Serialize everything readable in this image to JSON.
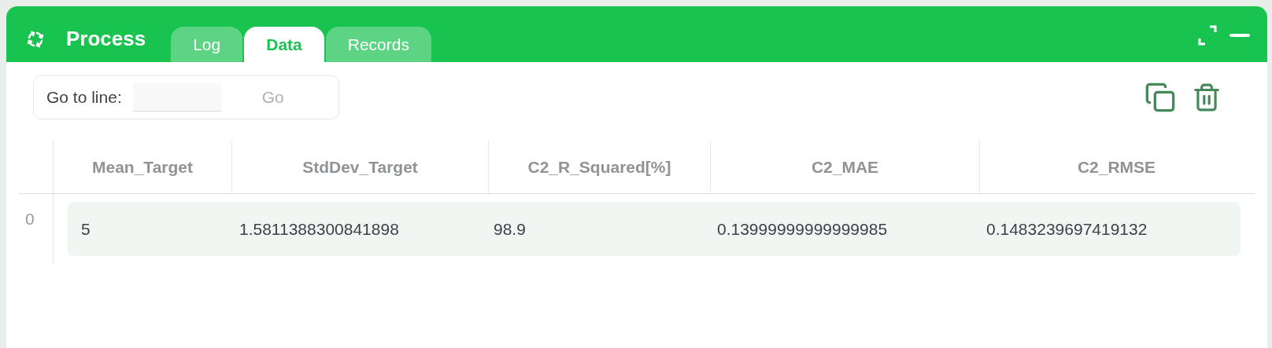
{
  "window": {
    "title": "Process"
  },
  "tabs": [
    {
      "label": "Log",
      "selected": false
    },
    {
      "label": "Data",
      "selected": true
    },
    {
      "label": "Records",
      "selected": false
    }
  ],
  "goto": {
    "label": "Go to line:",
    "button": "Go"
  },
  "table": {
    "columns": [
      "Mean_Target",
      "StdDev_Target",
      "C2_R_Squared[%]",
      "C2_MAE",
      "C2_RMSE"
    ],
    "rows": [
      {
        "index": "0",
        "cells": [
          "5",
          "1.5811388300841898",
          "98.9",
          "0.13999999999999985",
          "0.1483239697419132"
        ]
      }
    ]
  }
}
